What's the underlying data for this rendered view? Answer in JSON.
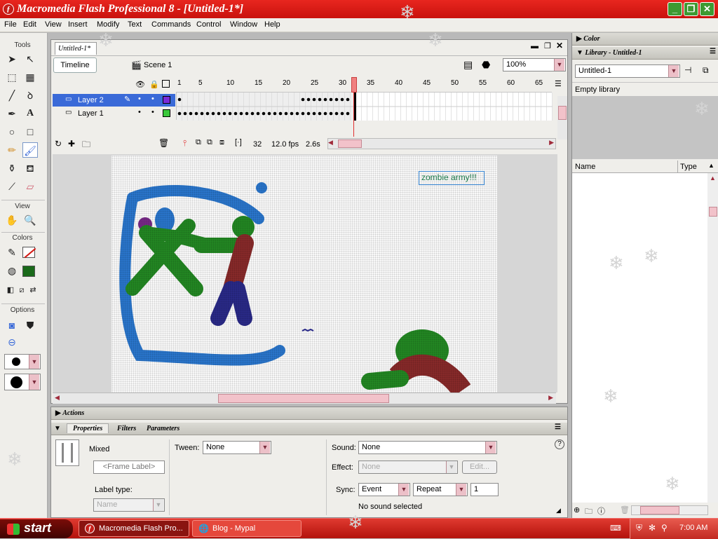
{
  "window": {
    "title": "Macromedia Flash Professional 8 - [Untitled-1*]",
    "app_icon": "flash-icon"
  },
  "menu": [
    "File",
    "Edit",
    "View",
    "Insert",
    "Modify",
    "Text",
    "Commands",
    "Control",
    "Window",
    "Help"
  ],
  "tools": {
    "label": "Tools",
    "view_label": "View",
    "colors_label": "Colors",
    "options_label": "Options"
  },
  "document": {
    "tab": "Untitled-1*",
    "timeline_label": "Timeline",
    "scene_label": "Scene 1",
    "zoom": "100%",
    "frame_numbers": [
      "1",
      "5",
      "10",
      "15",
      "20",
      "25",
      "30",
      "35",
      "40",
      "45",
      "50",
      "55",
      "60",
      "65"
    ],
    "layers": [
      {
        "name": "Layer 2"
      },
      {
        "name": "Layer 1"
      }
    ],
    "current_frame": "32",
    "fps": "12.0 fps",
    "time": "2.6s",
    "stage_text": "zombie army!!!"
  },
  "library": {
    "color_header": "Color",
    "header": "Library - Untitled-1",
    "doc_select": "Untitled-1",
    "empty_text": "Empty library",
    "col_name": "Name",
    "col_type": "Type"
  },
  "actions": {
    "header": "Actions"
  },
  "properties": {
    "tabs": [
      "Properties",
      "Filters",
      "Parameters"
    ],
    "frame_type": "Mixed",
    "frame_label_placeholder": "<Frame Label>",
    "tween_label": "Tween:",
    "tween_value": "None",
    "label_type_label": "Label type:",
    "label_type_value": "Name",
    "sound_label": "Sound:",
    "sound_value": "None",
    "effect_label": "Effect:",
    "effect_value": "None",
    "edit_btn": "Edit...",
    "sync_label": "Sync:",
    "sync_value": "Event",
    "repeat_value": "Repeat",
    "repeat_count": "1",
    "no_sound": "No sound selected"
  },
  "taskbar": {
    "start": "start",
    "tasks": [
      "Macromedia Flash Pro...",
      "Blog - Mypal"
    ],
    "clock": "7:00 AM"
  },
  "colors": {
    "accent_red": "#d41a14",
    "layer_selected": "#3a6ad8",
    "stroke_color": "#2a7a2a"
  }
}
